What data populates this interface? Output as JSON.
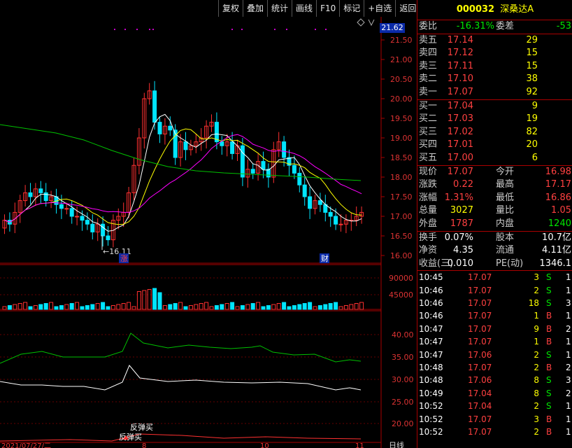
{
  "toolbar": [
    "复权",
    "叠加",
    "统计",
    "画线",
    "F10",
    "标记",
    "+自选",
    "返回"
  ],
  "stock": {
    "code": "000032",
    "name": "深桑达A"
  },
  "price_tag": "21.62",
  "y_axis_main": [
    "21.50",
    "21.00",
    "20.50",
    "20.00",
    "19.50",
    "19.00",
    "18.50",
    "18.00",
    "17.50",
    "17.00",
    "16.50",
    "16.00"
  ],
  "y_axis_vol": [
    "90000",
    "45000"
  ],
  "y_axis_ind": [
    "40.00",
    "35.00",
    "30.00",
    "25.00",
    "20.00"
  ],
  "low_label": "16.11",
  "markers": {
    "zhang": "涨",
    "cai": "财"
  },
  "signals": {
    "a": "反弹买",
    "b": "反弹买"
  },
  "date_label": "2021/07/27/二",
  "x_marks": [
    "8",
    "10",
    "11"
  ],
  "xaxis_right": "日线",
  "order_book": {
    "weibi": {
      "label": "委比",
      "value": "-16.31%"
    },
    "weicha": {
      "label": "委差",
      "value": "-53"
    },
    "sell": [
      {
        "label": "卖五",
        "price": "17.14",
        "qty": "29"
      },
      {
        "label": "卖四",
        "price": "17.12",
        "qty": "15"
      },
      {
        "label": "卖三",
        "price": "17.11",
        "qty": "15"
      },
      {
        "label": "卖二",
        "price": "17.10",
        "qty": "38"
      },
      {
        "label": "卖一",
        "price": "17.07",
        "qty": "92"
      }
    ],
    "buy": [
      {
        "label": "买一",
        "price": "17.04",
        "qty": "9"
      },
      {
        "label": "买二",
        "price": "17.03",
        "qty": "19"
      },
      {
        "label": "买三",
        "price": "17.02",
        "qty": "82"
      },
      {
        "label": "买四",
        "price": "17.01",
        "qty": "20"
      },
      {
        "label": "买五",
        "price": "17.00",
        "qty": "6"
      }
    ]
  },
  "quote": [
    [
      {
        "l": "现价",
        "v": "17.07",
        "c": "red"
      },
      {
        "l": "今开",
        "v": "16.98",
        "c": "red"
      }
    ],
    [
      {
        "l": "涨跌",
        "v": "0.22",
        "c": "red"
      },
      {
        "l": "最高",
        "v": "17.17",
        "c": "red"
      }
    ],
    [
      {
        "l": "涨幅",
        "v": "1.31%",
        "c": "red"
      },
      {
        "l": "最低",
        "v": "16.86",
        "c": "red"
      }
    ],
    [
      {
        "l": "总量",
        "v": "3027",
        "c": "yellow"
      },
      {
        "l": "量比",
        "v": "1.05",
        "c": "red"
      }
    ],
    [
      {
        "l": "外盘",
        "v": "1787",
        "c": "red"
      },
      {
        "l": "内盘",
        "v": "1240",
        "c": "green"
      }
    ]
  ],
  "fund": [
    [
      {
        "l": "换手",
        "v": "0.07%"
      },
      {
        "l": "股本",
        "v": "10.7亿"
      }
    ],
    [
      {
        "l": "净资",
        "v": "4.35"
      },
      {
        "l": "流通",
        "v": "4.11亿"
      }
    ],
    [
      {
        "l": "收益(三)",
        "v": "0.010"
      },
      {
        "l": "PE(动)",
        "v": "1346.1"
      }
    ]
  ],
  "ticks": [
    {
      "time": "10:45",
      "price": "17.07",
      "vol": "3",
      "flag": "S",
      "num": "1"
    },
    {
      "time": "10:46",
      "price": "17.07",
      "vol": "2",
      "flag": "S",
      "num": "1"
    },
    {
      "time": "10:46",
      "price": "17.07",
      "vol": "18",
      "flag": "S",
      "num": "3"
    },
    {
      "time": "10:46",
      "price": "17.07",
      "vol": "1",
      "flag": "B",
      "num": "1"
    },
    {
      "time": "10:47",
      "price": "17.07",
      "vol": "9",
      "flag": "B",
      "num": "2"
    },
    {
      "time": "10:47",
      "price": "17.07",
      "vol": "1",
      "flag": "B",
      "num": "1"
    },
    {
      "time": "10:47",
      "price": "17.06",
      "vol": "2",
      "flag": "S",
      "num": "1"
    },
    {
      "time": "10:48",
      "price": "17.07",
      "vol": "2",
      "flag": "B",
      "num": "2"
    },
    {
      "time": "10:48",
      "price": "17.06",
      "vol": "8",
      "flag": "S",
      "num": "3"
    },
    {
      "time": "10:49",
      "price": "17.04",
      "vol": "8",
      "flag": "S",
      "num": "2"
    },
    {
      "time": "10:52",
      "price": "17.04",
      "vol": "2",
      "flag": "S",
      "num": "1"
    },
    {
      "time": "10:52",
      "price": "17.07",
      "vol": "3",
      "flag": "B",
      "num": "1"
    },
    {
      "time": "10:52",
      "price": "17.07",
      "vol": "2",
      "flag": "B",
      "num": "1"
    }
  ],
  "colors": {
    "up": "#ff3030",
    "down": "#00e5ff",
    "axis": "#a00000",
    "ma5": "#ffffff",
    "ma10": "#ffff00",
    "ma20": "#ff00ff",
    "ma60": "#00c000"
  }
}
